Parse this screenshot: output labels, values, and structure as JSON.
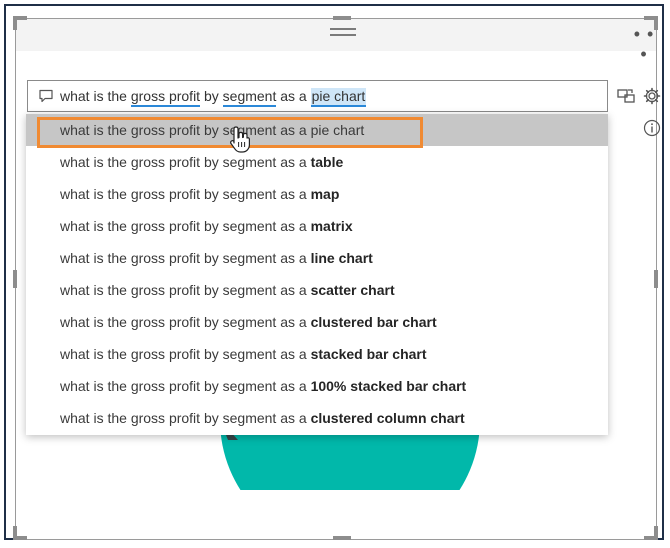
{
  "question_box": {
    "parts": {
      "p1": "what is the ",
      "gross_profit": "gross profit",
      "by": " by ",
      "segment": "segment",
      "as_a": " as a ",
      "pie_chart": "pie chart"
    }
  },
  "suggestions": [
    {
      "prefix": "what is the gross profit by segment as a pie chart",
      "bold": ""
    },
    {
      "prefix": "what is the gross profit by segment as a ",
      "bold": "table"
    },
    {
      "prefix": "what is the gross profit by segment as a ",
      "bold": "map"
    },
    {
      "prefix": "what is the gross profit by segment as a ",
      "bold": "matrix"
    },
    {
      "prefix": "what is the gross profit by segment as a ",
      "bold": "line chart"
    },
    {
      "prefix": "what is the gross profit by segment as a ",
      "bold": "scatter chart"
    },
    {
      "prefix": "what is the gross profit by segment as a ",
      "bold": "clustered bar chart"
    },
    {
      "prefix": "what is the gross profit by segment as a ",
      "bold": "stacked bar chart"
    },
    {
      "prefix": "what is the gross profit by segment as a ",
      "bold": "100% stacked bar chart"
    },
    {
      "prefix": "what is the gross profit by segment as a ",
      "bold": "clustered column chart"
    }
  ],
  "selected_index": 0,
  "more_options": "• • •",
  "colors": {
    "accent_blue": "#2b88d8",
    "highlight_orange": "#f08a32",
    "pie_teal": "#01b8aa",
    "pie_dark": "#374649"
  },
  "icons": {
    "chat": "chat-bubble-icon",
    "convert": "convert-to-visual-icon",
    "settings": "settings-gear-icon",
    "info": "info-icon",
    "more": "more-options-icon",
    "cursor": "hand-cursor-icon"
  }
}
